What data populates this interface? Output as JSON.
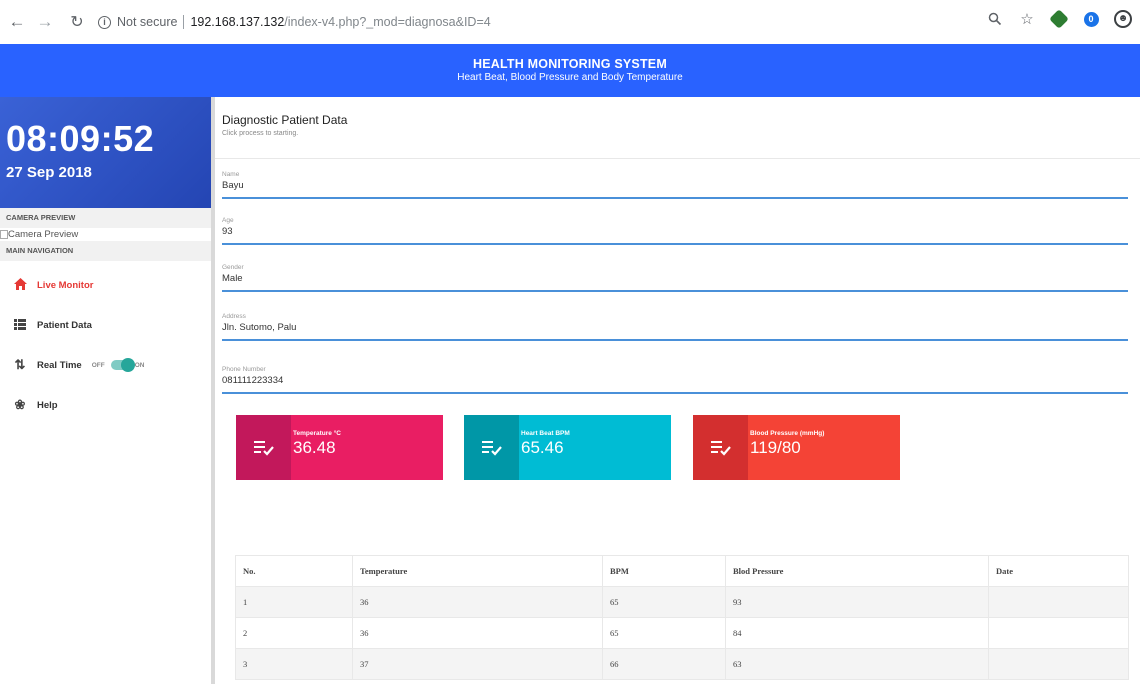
{
  "browser": {
    "security_label": "Not secure",
    "url_host": "192.168.137.132",
    "url_path": "/index-v4.php?_mod=diagnosa&ID=4"
  },
  "header": {
    "title": "HEALTH MONITORING SYSTEM",
    "subtitle": "Heart Beat, Blood Pressure and Body Temperature"
  },
  "sidebar": {
    "time": "08:09:52",
    "date": "27 Sep 2018",
    "camera_header": "CAMERA PREVIEW",
    "camera_alt": "Camera Preview",
    "nav_header": "MAIN NAVIGATION",
    "items": [
      {
        "label": "Live Monitor",
        "icon": "home-icon"
      },
      {
        "label": "Patient Data",
        "icon": "list-icon"
      },
      {
        "label": "Real Time",
        "icon": "swap-icon"
      },
      {
        "label": "Help",
        "icon": "help-icon"
      }
    ],
    "toggle_off": "OFF",
    "toggle_on": "ON",
    "toggle_state": "on"
  },
  "main": {
    "title": "Diagnostic Patient Data",
    "subtitle": "Click process to starting.",
    "fields": [
      {
        "label": "Name",
        "value": "Bayu"
      },
      {
        "label": "Age",
        "value": "93"
      },
      {
        "label": "Gender",
        "value": "Male"
      },
      {
        "label": "Address",
        "value": "Jln. Sutomo, Palu"
      },
      {
        "label": "Phone Number",
        "value": "081111223334"
      }
    ],
    "stats": [
      {
        "label": "Temperature °C",
        "value": "36.48",
        "color": "#e91e63"
      },
      {
        "label": "Heart Beat BPM",
        "value": "65.46",
        "color": "#00bcd4"
      },
      {
        "label": "Blood Pressure (mmHg)",
        "value": "119/80",
        "color": "#f44336"
      }
    ],
    "table": {
      "headers": [
        "No.",
        "Temperature",
        "BPM",
        "Blod Pressure",
        "Date"
      ],
      "rows": [
        [
          "1",
          "36",
          "65",
          "93",
          ""
        ],
        [
          "2",
          "36",
          "65",
          "84",
          ""
        ],
        [
          "3",
          "37",
          "66",
          "63",
          ""
        ]
      ]
    }
  },
  "colors": {
    "header_bg": "#2962ff",
    "clock_bg": "#2f56c9",
    "active_nav": "#e53935",
    "field_underline": "#4a90d9"
  }
}
